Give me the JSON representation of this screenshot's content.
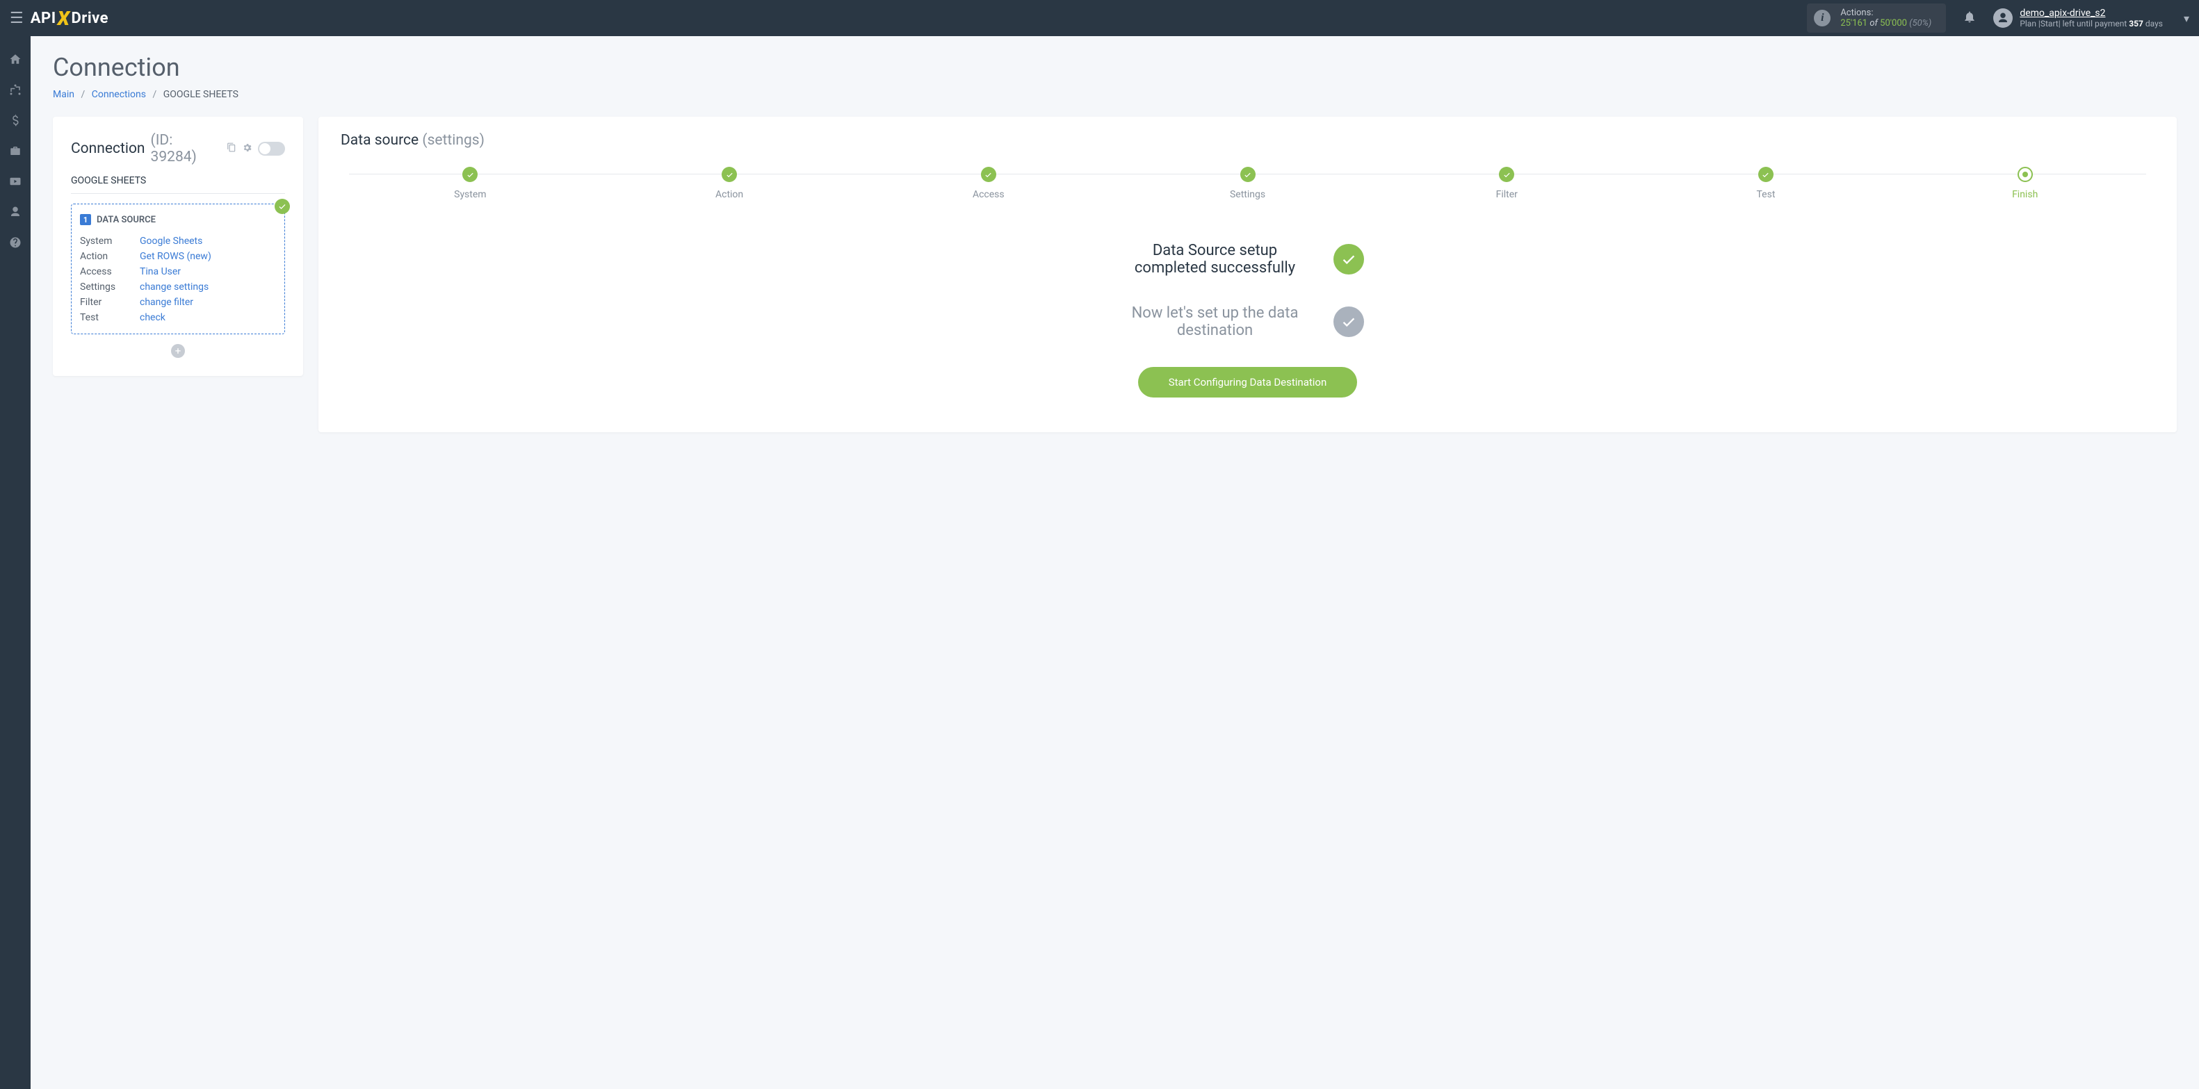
{
  "header": {
    "logo_parts": {
      "api": "API",
      "x": "X",
      "drive": "Drive"
    },
    "actions": {
      "label": "Actions:",
      "current": "25'161",
      "of": "of",
      "total": "50'000",
      "pct": "(50%)"
    },
    "user": {
      "name": "demo_apix-drive_s2",
      "plan_prefix": "Plan |Start| left until payment",
      "days": "357",
      "days_suffix": "days"
    }
  },
  "page": {
    "title": "Connection",
    "breadcrumbs": {
      "main": "Main",
      "connections": "Connections",
      "current": "GOOGLE SHEETS"
    }
  },
  "left": {
    "title": "Connection",
    "id_label": "(ID: 39284)",
    "service": "GOOGLE SHEETS",
    "ds_title": "DATA SOURCE",
    "rows": {
      "System": "Google Sheets",
      "Action": "Get ROWS (new)",
      "Access": "Tina User",
      "Settings": "change settings",
      "Filter": "change filter",
      "Test": "check"
    }
  },
  "right": {
    "title": "Data source",
    "title_sub": "(settings)",
    "steps": [
      "System",
      "Action",
      "Access",
      "Settings",
      "Filter",
      "Test",
      "Finish"
    ],
    "done_msg": "Data Source setup completed successfully",
    "next_msg": "Now let's set up the data destination",
    "cta": "Start Configuring Data Destination"
  }
}
